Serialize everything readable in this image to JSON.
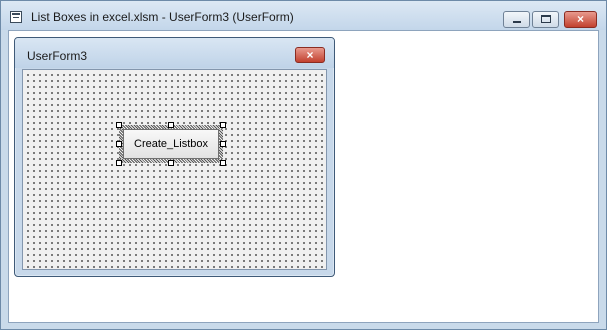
{
  "window": {
    "title": "List Boxes in excel.xlsm - UserForm3 (UserForm)",
    "icon": "userform-window-icon",
    "controls": [
      "minimize",
      "maximize",
      "close"
    ]
  },
  "userform": {
    "title": "UserForm3",
    "close_glyph": "×",
    "button": {
      "label": "Create_Listbox",
      "selected": true
    }
  },
  "caption_glyphs": {
    "close": "×"
  },
  "colors": {
    "titlebar": "#c9daea",
    "close_button": "#c2412f",
    "canvas": "#f0f0f0",
    "grid_dots": "#303030"
  }
}
